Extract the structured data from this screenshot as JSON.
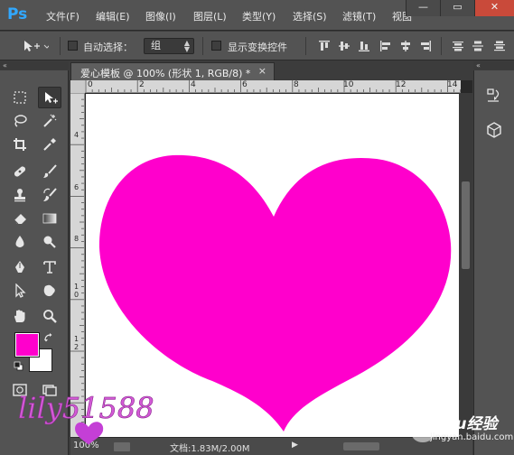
{
  "app": {
    "logo": "Ps"
  },
  "menu": {
    "items": [
      "文件(F)",
      "编辑(E)",
      "图像(I)",
      "图层(L)",
      "类型(Y)",
      "选择(S)",
      "滤镜(T)",
      "视图"
    ]
  },
  "window_controls": {
    "minimize": "—",
    "maximize": "▭",
    "close": "✕"
  },
  "options": {
    "auto_select_label": "自动选择：",
    "auto_select_value": "组",
    "show_transform_label": "显示变换控件"
  },
  "document": {
    "tab_title": "爱心模板 @ 100% (形状 1, RGB/8) *",
    "close_glyph": "×",
    "shape_color": "#ff00cc"
  },
  "rulers": {
    "horizontal": [
      "0",
      "2",
      "4",
      "6",
      "8",
      "10",
      "12",
      "14"
    ],
    "vertical_labels": [
      "4",
      "6",
      "8",
      "10",
      "12"
    ]
  },
  "colors": {
    "foreground": "#ff00cc",
    "background": "#ffffff"
  },
  "status": {
    "zoom": "100%",
    "doc_info": "文档:1.83M/2.00M",
    "arrow": "▶"
  },
  "watermark": {
    "signature": "lily51588",
    "site_name": "Baidu经验",
    "site_url": "jingyan.baidu.com"
  },
  "icons": {
    "toolbar": [
      "marquee-icon",
      "move-icon",
      "lasso-icon",
      "magic-wand-icon",
      "crop-icon",
      "eyedropper-icon",
      "healing-brush-icon",
      "brush-icon",
      "stamp-icon",
      "history-brush-icon",
      "eraser-icon",
      "gradient-icon",
      "blur-icon",
      "dodge-icon",
      "pen-icon",
      "type-icon",
      "path-selection-icon",
      "shape-icon",
      "hand-icon",
      "zoom-icon"
    ],
    "dock": [
      "history-panel-icon",
      "3d-panel-icon"
    ]
  }
}
